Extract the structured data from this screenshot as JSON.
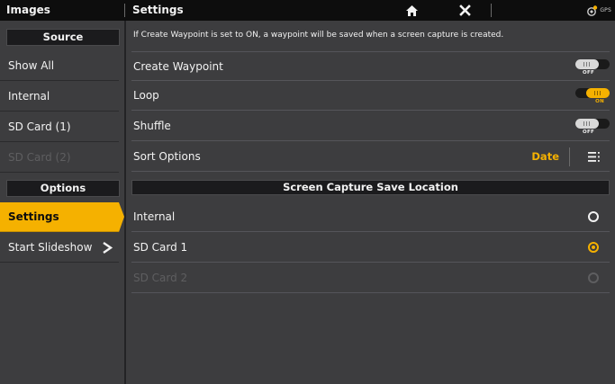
{
  "topbar": {
    "left_title": "Images",
    "right_title": "Settings",
    "home_icon": "home-icon",
    "close_icon": "close-icon",
    "gps_label": "GPS"
  },
  "sidebar": {
    "source_header": "Source",
    "source_items": [
      {
        "label": "Show All",
        "enabled": true
      },
      {
        "label": "Internal",
        "enabled": true
      },
      {
        "label": "SD Card (1)",
        "enabled": true
      },
      {
        "label": "SD Card (2)",
        "enabled": false
      }
    ],
    "options_header": "Options",
    "options_items": [
      {
        "label": "Settings",
        "active": true
      },
      {
        "label": "Start Slideshow",
        "icon": "chevron-right-icon"
      }
    ]
  },
  "settings": {
    "info": "If Create Waypoint is set to ON, a waypoint will be saved when a screen capture is created.",
    "rows": [
      {
        "label": "Create Waypoint",
        "toggle": "OFF"
      },
      {
        "label": "Loop",
        "toggle": "ON"
      },
      {
        "label": "Shuffle",
        "toggle": "OFF"
      }
    ],
    "sort": {
      "label": "Sort Options",
      "value": "Date",
      "icon": "list-menu-icon"
    },
    "save_location": {
      "header": "Screen Capture Save Location",
      "options": [
        {
          "label": "Internal",
          "state": "unselected"
        },
        {
          "label": "SD Card 1",
          "state": "selected"
        },
        {
          "label": "SD Card 2",
          "state": "disabled"
        }
      ]
    }
  },
  "colors": {
    "accent": "#f5b100",
    "background": "#3d3d3f",
    "topbar": "#0d0d0d",
    "disabled_text": "#5e5e60"
  }
}
